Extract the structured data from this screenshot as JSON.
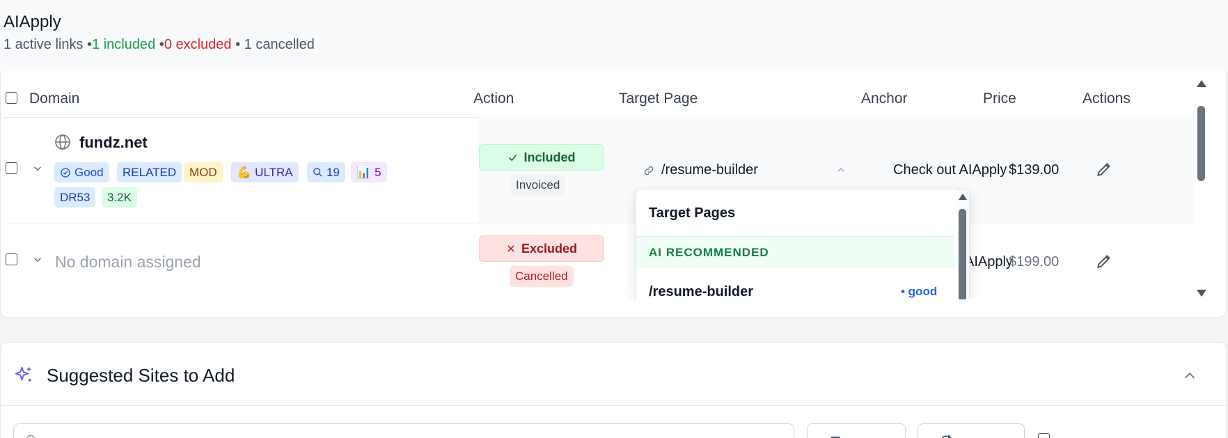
{
  "client": {
    "name": "AIApply",
    "stats": {
      "active": "1 active links •",
      "included": "1 included",
      "sep1": " •",
      "excluded": "0 excluded",
      "cancelled": " • 1 cancelled"
    }
  },
  "table": {
    "headers": {
      "domain": "Domain",
      "action": "Action",
      "target": "Target Page",
      "anchor": "Anchor",
      "price": "Price",
      "actions": "Actions"
    },
    "rows": [
      {
        "domain": "fundz.net",
        "tags": {
          "quality": "Good",
          "related": "RELATED",
          "mod": "MOD",
          "ultra": "ULTRA",
          "search": "19",
          "stats": "5",
          "dr": "DR53",
          "traffic": "3.2K"
        },
        "status": "Included",
        "sub_status": "Invoiced",
        "target_page": "/resume-builder",
        "anchor": "Check out AIApply",
        "price": "$139.00"
      },
      {
        "domain": "No domain assigned",
        "status": "Excluded",
        "sub_status": "Cancelled",
        "anchor": "AIApply",
        "price": "$199.00"
      }
    ]
  },
  "dropdown": {
    "title": "Target Pages",
    "section": "AI RECOMMENDED",
    "item": "/resume-builder",
    "item_quality": "• good"
  },
  "suggested": {
    "title": "Suggested Sites to Add"
  },
  "colors": {
    "included": "#16a34a",
    "excluded": "#dc2626",
    "accent": "#6366f1"
  }
}
